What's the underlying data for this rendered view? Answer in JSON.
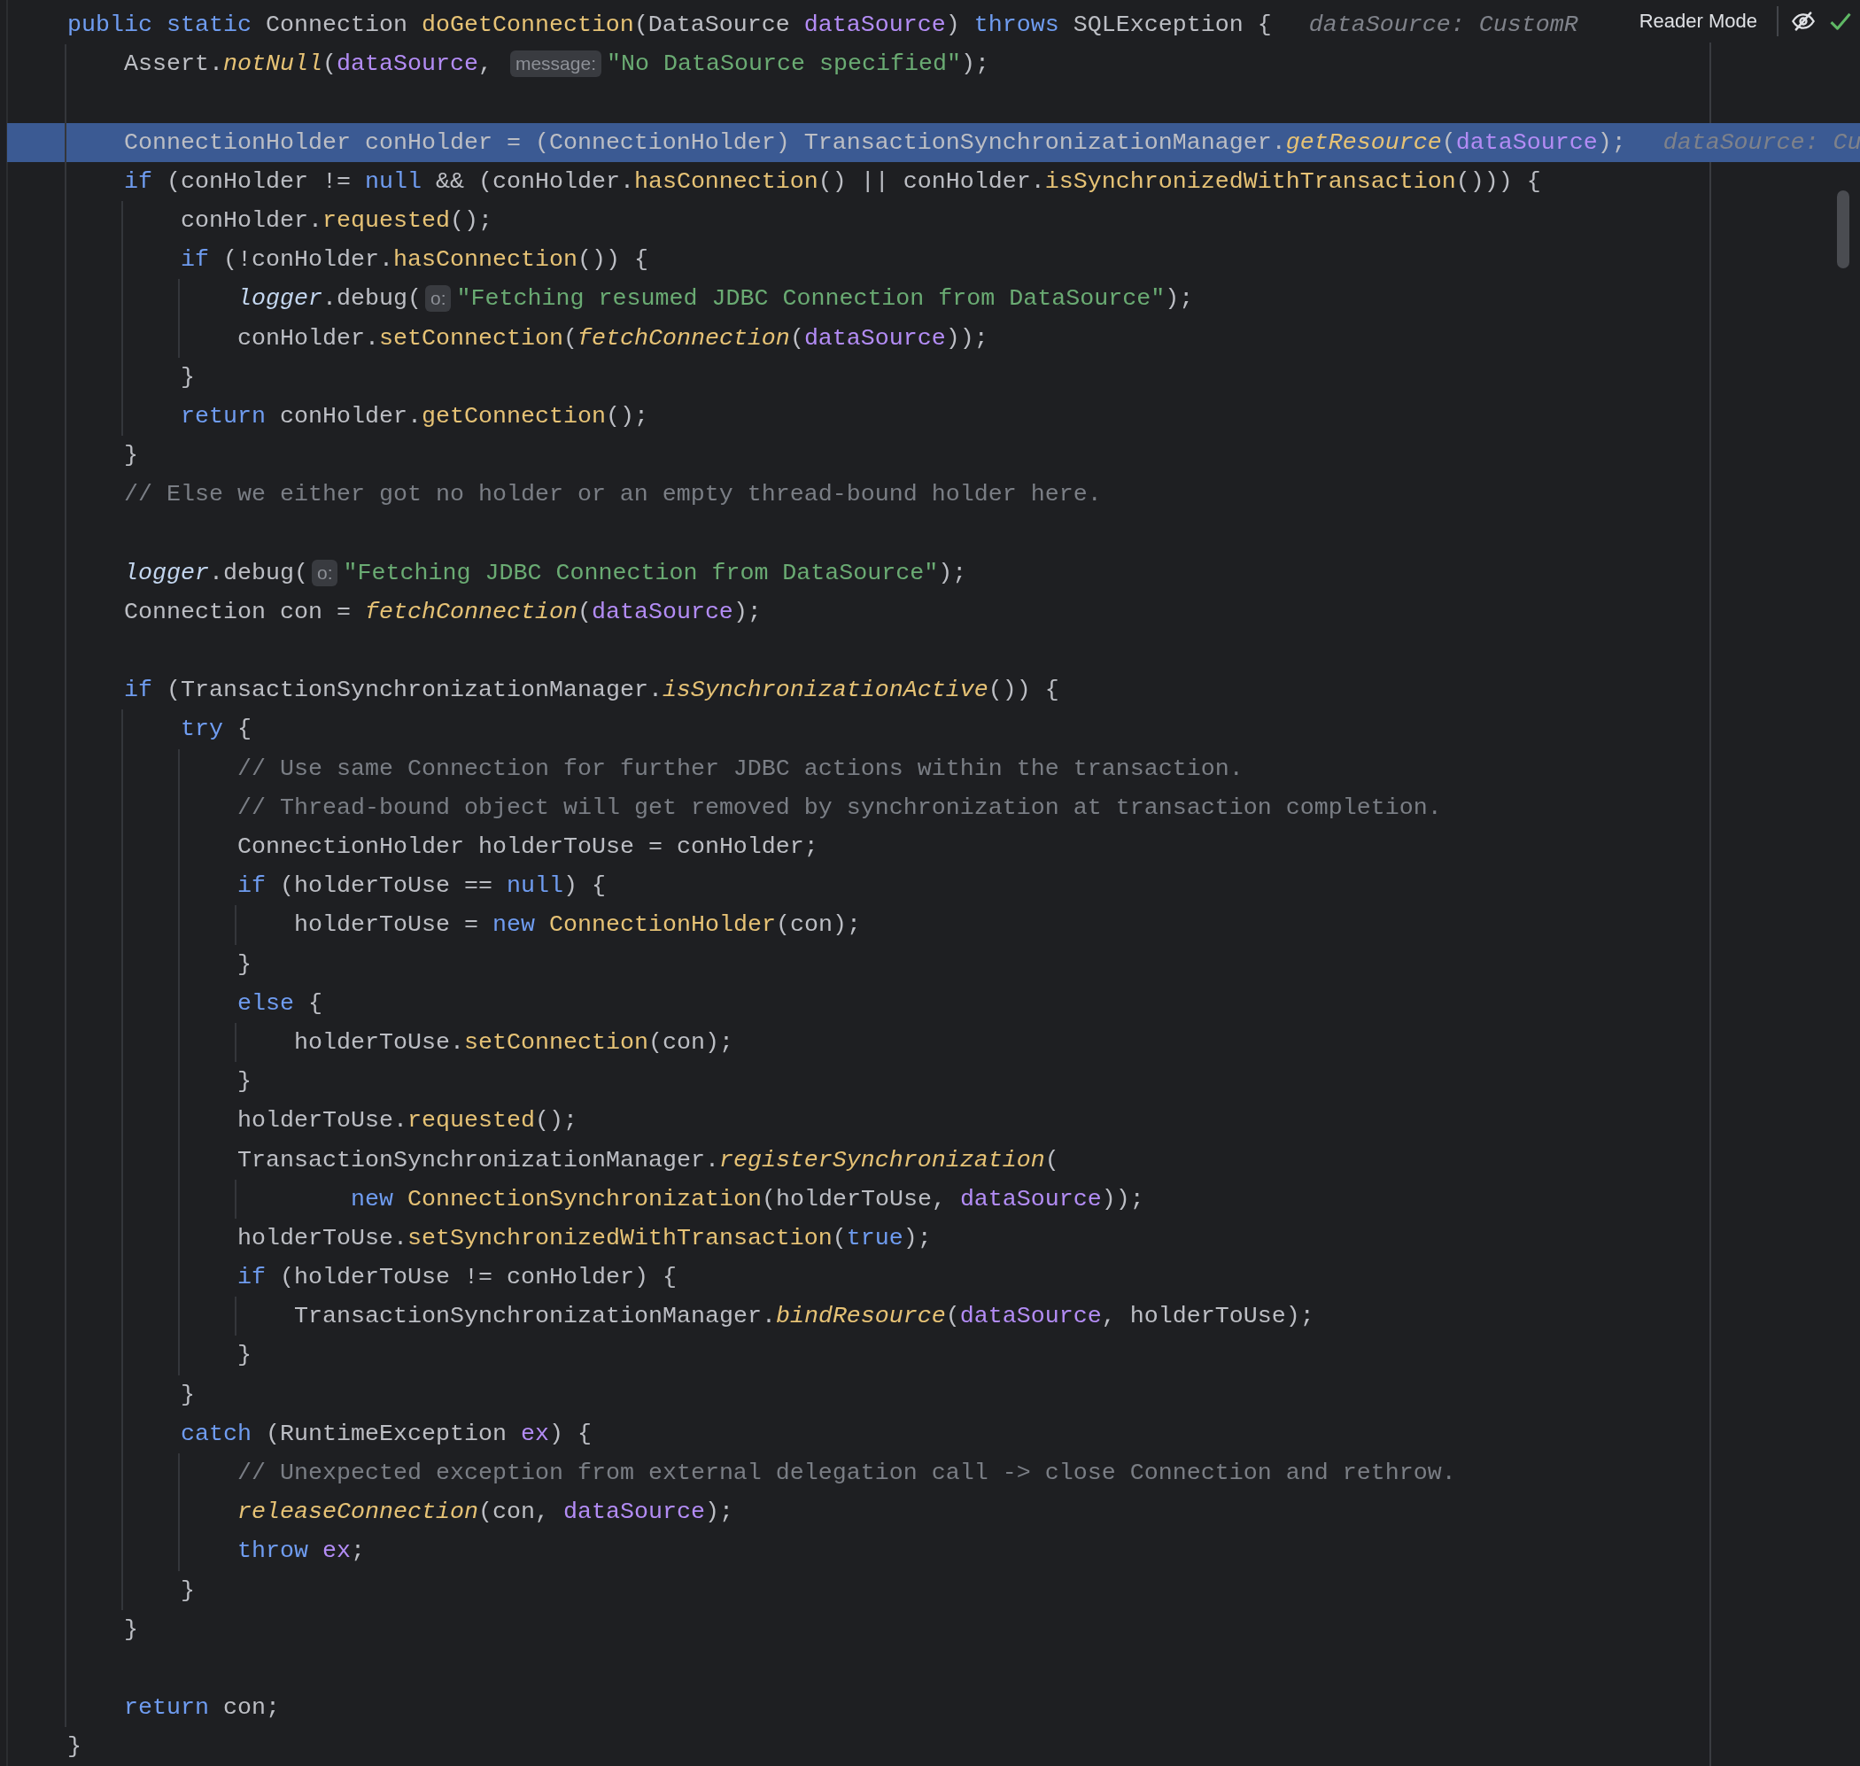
{
  "toolbar": {
    "reader_mode": "Reader Mode"
  },
  "lines": [
    {
      "selected": false,
      "parts": [
        {
          "kind": "code",
          "tokens": [
            {
              "text": "public static ",
              "kind": "keyword"
            },
            {
              "text": "Connection ",
              "kind": "plain"
            },
            {
              "text": "doGetConnection",
              "kind": "method"
            },
            {
              "text": "(DataSource ",
              "kind": "plain"
            },
            {
              "text": "dataSource",
              "kind": "parameter"
            },
            {
              "text": ") ",
              "kind": "plain"
            },
            {
              "text": "throws ",
              "kind": "keyword"
            },
            {
              "text": "SQLException {",
              "kind": "plain"
            }
          ]
        },
        {
          "kind": "hint",
          "text": "dataSource: CustomR"
        }
      ],
      "children": [
        {
          "selected": false,
          "parts": [
            {
              "kind": "code",
              "tokens": [
                {
                  "text": "Assert.",
                  "kind": "plain"
                },
                {
                  "text": "notNull",
                  "kind": "static-method"
                },
                {
                  "text": "(",
                  "kind": "plain"
                },
                {
                  "text": "dataSource",
                  "kind": "parameter"
                },
                {
                  "text": ", ",
                  "kind": "plain"
                }
              ]
            },
            {
              "kind": "chip",
              "text": "message:"
            },
            {
              "kind": "code",
              "tokens": [
                {
                  "text": "\"No DataSource specified\"",
                  "kind": "string"
                },
                {
                  "text": ");",
                  "kind": "plain"
                }
              ]
            }
          ]
        },
        {
          "selected": false
        },
        {
          "selected": true,
          "parts": [
            {
              "kind": "code",
              "tokens": [
                {
                  "text": "ConnectionHolder conHolder = (ConnectionHolder) TransactionSynchronizationManager.",
                  "kind": "plain"
                },
                {
                  "text": "getResource",
                  "kind": "static-method"
                },
                {
                  "text": "(",
                  "kind": "plain"
                },
                {
                  "text": "dataSource",
                  "kind": "parameter"
                },
                {
                  "text": ");",
                  "kind": "plain"
                }
              ]
            },
            {
              "kind": "hint",
              "text": "dataSource: Cu"
            }
          ]
        },
        {
          "selected": false,
          "parts": [
            {
              "kind": "code",
              "tokens": [
                {
                  "text": "if ",
                  "kind": "keyword"
                },
                {
                  "text": "(conHolder != ",
                  "kind": "plain"
                },
                {
                  "text": "null ",
                  "kind": "keyword"
                },
                {
                  "text": "&& (conHolder.",
                  "kind": "plain"
                },
                {
                  "text": "hasConnection",
                  "kind": "method"
                },
                {
                  "text": "() || conHolder.",
                  "kind": "plain"
                },
                {
                  "text": "isSynchronizedWithTransaction",
                  "kind": "method"
                },
                {
                  "text": "())) {",
                  "kind": "plain"
                }
              ]
            }
          ],
          "children": [
            {
              "selected": false,
              "parts": [
                {
                  "kind": "code",
                  "tokens": [
                    {
                      "text": "conHolder.",
                      "kind": "plain"
                    },
                    {
                      "text": "requested",
                      "kind": "method"
                    },
                    {
                      "text": "();",
                      "kind": "plain"
                    }
                  ]
                }
              ]
            },
            {
              "selected": false,
              "parts": [
                {
                  "kind": "code",
                  "tokens": [
                    {
                      "text": "if ",
                      "kind": "keyword"
                    },
                    {
                      "text": "(!conHolder.",
                      "kind": "plain"
                    },
                    {
                      "text": "hasConnection",
                      "kind": "method"
                    },
                    {
                      "text": "()) {",
                      "kind": "plain"
                    }
                  ]
                }
              ],
              "children": [
                {
                  "selected": false,
                  "parts": [
                    {
                      "kind": "code",
                      "tokens": [
                        {
                          "text": "logger",
                          "kind": "field"
                        },
                        {
                          "text": ".debug(",
                          "kind": "plain"
                        }
                      ]
                    },
                    {
                      "kind": "chip",
                      "text": "o:"
                    },
                    {
                      "kind": "code",
                      "tokens": [
                        {
                          "text": "\"Fetching resumed JDBC Connection from DataSource\"",
                          "kind": "string"
                        },
                        {
                          "text": ");",
                          "kind": "plain"
                        }
                      ]
                    }
                  ]
                },
                {
                  "selected": false,
                  "parts": [
                    {
                      "kind": "code",
                      "tokens": [
                        {
                          "text": "conHolder.",
                          "kind": "plain"
                        },
                        {
                          "text": "setConnection",
                          "kind": "method"
                        },
                        {
                          "text": "(",
                          "kind": "plain"
                        },
                        {
                          "text": "fetchConnection",
                          "kind": "static-method"
                        },
                        {
                          "text": "(",
                          "kind": "plain"
                        },
                        {
                          "text": "dataSource",
                          "kind": "parameter"
                        },
                        {
                          "text": "));",
                          "kind": "plain"
                        }
                      ]
                    }
                  ]
                }
              ]
            },
            {
              "selected": false,
              "parts": [
                {
                  "kind": "code",
                  "tokens": [
                    {
                      "text": "}",
                      "kind": "plain"
                    }
                  ]
                }
              ]
            },
            {
              "selected": false,
              "parts": [
                {
                  "kind": "code",
                  "tokens": [
                    {
                      "text": "return ",
                      "kind": "keyword"
                    },
                    {
                      "text": "conHolder.",
                      "kind": "plain"
                    },
                    {
                      "text": "getConnection",
                      "kind": "method"
                    },
                    {
                      "text": "();",
                      "kind": "plain"
                    }
                  ]
                }
              ]
            }
          ]
        },
        {
          "selected": false,
          "parts": [
            {
              "kind": "code",
              "tokens": [
                {
                  "text": "}",
                  "kind": "plain"
                }
              ]
            }
          ]
        },
        {
          "selected": false,
          "parts": [
            {
              "kind": "code",
              "tokens": [
                {
                  "text": "// Else we either got no holder or an empty thread-bound holder here.",
                  "kind": "comment"
                }
              ]
            }
          ]
        },
        {
          "selected": false
        },
        {
          "selected": false,
          "parts": [
            {
              "kind": "code",
              "tokens": [
                {
                  "text": "logger",
                  "kind": "field"
                },
                {
                  "text": ".debug(",
                  "kind": "plain"
                }
              ]
            },
            {
              "kind": "chip",
              "text": "o:"
            },
            {
              "kind": "code",
              "tokens": [
                {
                  "text": "\"Fetching JDBC Connection from DataSource\"",
                  "kind": "string"
                },
                {
                  "text": ");",
                  "kind": "plain"
                }
              ]
            }
          ]
        },
        {
          "selected": false,
          "parts": [
            {
              "kind": "code",
              "tokens": [
                {
                  "text": "Connection con = ",
                  "kind": "plain"
                },
                {
                  "text": "fetchConnection",
                  "kind": "static-method"
                },
                {
                  "text": "(",
                  "kind": "plain"
                },
                {
                  "text": "dataSource",
                  "kind": "parameter"
                },
                {
                  "text": ");",
                  "kind": "plain"
                }
              ]
            }
          ]
        },
        {
          "selected": false
        },
        {
          "selected": false,
          "parts": [
            {
              "kind": "code",
              "tokens": [
                {
                  "text": "if ",
                  "kind": "keyword"
                },
                {
                  "text": "(TransactionSynchronizationManager.",
                  "kind": "plain"
                },
                {
                  "text": "isSynchronizationActive",
                  "kind": "static-method"
                },
                {
                  "text": "()) {",
                  "kind": "plain"
                }
              ]
            }
          ],
          "children": [
            {
              "selected": false,
              "parts": [
                {
                  "kind": "code",
                  "tokens": [
                    {
                      "text": "try ",
                      "kind": "keyword"
                    },
                    {
                      "text": "{",
                      "kind": "plain"
                    }
                  ]
                }
              ],
              "children": [
                {
                  "selected": false,
                  "parts": [
                    {
                      "kind": "code",
                      "tokens": [
                        {
                          "text": "// Use same Connection for further JDBC actions within the transaction.",
                          "kind": "comment"
                        }
                      ]
                    }
                  ]
                },
                {
                  "selected": false,
                  "parts": [
                    {
                      "kind": "code",
                      "tokens": [
                        {
                          "text": "// Thread-bound object will get removed by synchronization at transaction completion.",
                          "kind": "comment"
                        }
                      ]
                    }
                  ]
                },
                {
                  "selected": false,
                  "parts": [
                    {
                      "kind": "code",
                      "tokens": [
                        {
                          "text": "ConnectionHolder holderToUse = conHolder;",
                          "kind": "plain"
                        }
                      ]
                    }
                  ]
                },
                {
                  "selected": false,
                  "parts": [
                    {
                      "kind": "code",
                      "tokens": [
                        {
                          "text": "if ",
                          "kind": "keyword"
                        },
                        {
                          "text": "(holderToUse == ",
                          "kind": "plain"
                        },
                        {
                          "text": "null",
                          "kind": "keyword"
                        },
                        {
                          "text": ") {",
                          "kind": "plain"
                        }
                      ]
                    }
                  ],
                  "children": [
                    {
                      "selected": false,
                      "parts": [
                        {
                          "kind": "code",
                          "tokens": [
                            {
                              "text": "holderToUse = ",
                              "kind": "plain"
                            },
                            {
                              "text": "new ",
                              "kind": "keyword"
                            },
                            {
                              "text": "ConnectionHolder",
                              "kind": "method"
                            },
                            {
                              "text": "(con);",
                              "kind": "plain"
                            }
                          ]
                        }
                      ]
                    }
                  ]
                },
                {
                  "selected": false,
                  "parts": [
                    {
                      "kind": "code",
                      "tokens": [
                        {
                          "text": "}",
                          "kind": "plain"
                        }
                      ]
                    }
                  ]
                },
                {
                  "selected": false,
                  "parts": [
                    {
                      "kind": "code",
                      "tokens": [
                        {
                          "text": "else ",
                          "kind": "keyword"
                        },
                        {
                          "text": "{",
                          "kind": "plain"
                        }
                      ]
                    }
                  ],
                  "children": [
                    {
                      "selected": false,
                      "parts": [
                        {
                          "kind": "code",
                          "tokens": [
                            {
                              "text": "holderToUse.",
                              "kind": "plain"
                            },
                            {
                              "text": "setConnection",
                              "kind": "method"
                            },
                            {
                              "text": "(con);",
                              "kind": "plain"
                            }
                          ]
                        }
                      ]
                    }
                  ]
                },
                {
                  "selected": false,
                  "parts": [
                    {
                      "kind": "code",
                      "tokens": [
                        {
                          "text": "}",
                          "kind": "plain"
                        }
                      ]
                    }
                  ]
                },
                {
                  "selected": false,
                  "parts": [
                    {
                      "kind": "code",
                      "tokens": [
                        {
                          "text": "holderToUse.",
                          "kind": "plain"
                        },
                        {
                          "text": "requested",
                          "kind": "method"
                        },
                        {
                          "text": "();",
                          "kind": "plain"
                        }
                      ]
                    }
                  ]
                },
                {
                  "selected": false,
                  "parts": [
                    {
                      "kind": "code",
                      "tokens": [
                        {
                          "text": "TransactionSynchronizationManager.",
                          "kind": "plain"
                        },
                        {
                          "text": "registerSynchronization",
                          "kind": "static-method"
                        },
                        {
                          "text": "(",
                          "kind": "plain"
                        }
                      ]
                    }
                  ],
                  "children": [
                    {
                      "selected": false,
                      "kind": "continuation",
                      "parts": [
                        {
                          "kind": "code",
                          "tokens": [
                            {
                              "text": "new ",
                              "kind": "keyword"
                            },
                            {
                              "text": "ConnectionSynchronization",
                              "kind": "method"
                            },
                            {
                              "text": "(holderToUse, ",
                              "kind": "plain"
                            },
                            {
                              "text": "dataSource",
                              "kind": "parameter"
                            },
                            {
                              "text": "));",
                              "kind": "plain"
                            }
                          ]
                        }
                      ]
                    }
                  ]
                },
                {
                  "selected": false,
                  "parts": [
                    {
                      "kind": "code",
                      "tokens": [
                        {
                          "text": "holderToUse.",
                          "kind": "plain"
                        },
                        {
                          "text": "setSynchronizedWithTransaction",
                          "kind": "method"
                        },
                        {
                          "text": "(",
                          "kind": "plain"
                        },
                        {
                          "text": "true",
                          "kind": "keyword"
                        },
                        {
                          "text": ");",
                          "kind": "plain"
                        }
                      ]
                    }
                  ]
                },
                {
                  "selected": false,
                  "parts": [
                    {
                      "kind": "code",
                      "tokens": [
                        {
                          "text": "if ",
                          "kind": "keyword"
                        },
                        {
                          "text": "(holderToUse != conHolder) {",
                          "kind": "plain"
                        }
                      ]
                    }
                  ],
                  "children": [
                    {
                      "selected": false,
                      "parts": [
                        {
                          "kind": "code",
                          "tokens": [
                            {
                              "text": "TransactionSynchronizationManager.",
                              "kind": "plain"
                            },
                            {
                              "text": "bindResource",
                              "kind": "static-method"
                            },
                            {
                              "text": "(",
                              "kind": "plain"
                            },
                            {
                              "text": "dataSource",
                              "kind": "parameter"
                            },
                            {
                              "text": ", holderToUse);",
                              "kind": "plain"
                            }
                          ]
                        }
                      ]
                    }
                  ]
                },
                {
                  "selected": false,
                  "parts": [
                    {
                      "kind": "code",
                      "tokens": [
                        {
                          "text": "}",
                          "kind": "plain"
                        }
                      ]
                    }
                  ]
                }
              ]
            },
            {
              "selected": false,
              "parts": [
                {
                  "kind": "code",
                  "tokens": [
                    {
                      "text": "}",
                      "kind": "plain"
                    }
                  ]
                }
              ]
            },
            {
              "selected": false,
              "parts": [
                {
                  "kind": "code",
                  "tokens": [
                    {
                      "text": "catch ",
                      "kind": "keyword"
                    },
                    {
                      "text": "(RuntimeException ",
                      "kind": "plain"
                    },
                    {
                      "text": "ex",
                      "kind": "parameter"
                    },
                    {
                      "text": ") {",
                      "kind": "plain"
                    }
                  ]
                }
              ],
              "children": [
                {
                  "selected": false,
                  "parts": [
                    {
                      "kind": "code",
                      "tokens": [
                        {
                          "text": "// Unexpected exception from external delegation call -> close Connection and rethrow.",
                          "kind": "comment"
                        }
                      ]
                    }
                  ]
                },
                {
                  "selected": false,
                  "parts": [
                    {
                      "kind": "code",
                      "tokens": [
                        {
                          "text": "releaseConnection",
                          "kind": "static-method"
                        },
                        {
                          "text": "(con, ",
                          "kind": "plain"
                        },
                        {
                          "text": "dataSource",
                          "kind": "parameter"
                        },
                        {
                          "text": ");",
                          "kind": "plain"
                        }
                      ]
                    }
                  ]
                },
                {
                  "selected": false,
                  "parts": [
                    {
                      "kind": "code",
                      "tokens": [
                        {
                          "text": "throw ",
                          "kind": "keyword"
                        },
                        {
                          "text": "ex",
                          "kind": "parameter"
                        },
                        {
                          "text": ";",
                          "kind": "plain"
                        }
                      ]
                    }
                  ]
                }
              ]
            },
            {
              "selected": false,
              "parts": [
                {
                  "kind": "code",
                  "tokens": [
                    {
                      "text": "}",
                      "kind": "plain"
                    }
                  ]
                }
              ]
            }
          ]
        },
        {
          "selected": false,
          "parts": [
            {
              "kind": "code",
              "tokens": [
                {
                  "text": "}",
                  "kind": "plain"
                }
              ]
            }
          ]
        },
        {
          "selected": false
        },
        {
          "selected": false,
          "parts": [
            {
              "kind": "code",
              "tokens": [
                {
                  "text": "return ",
                  "kind": "keyword"
                },
                {
                  "text": "con;",
                  "kind": "plain"
                }
              ]
            }
          ]
        }
      ]
    },
    {
      "selected": false,
      "parts": [
        {
          "kind": "code",
          "tokens": [
            {
              "text": "}",
              "kind": "plain"
            }
          ]
        }
      ]
    }
  ]
}
